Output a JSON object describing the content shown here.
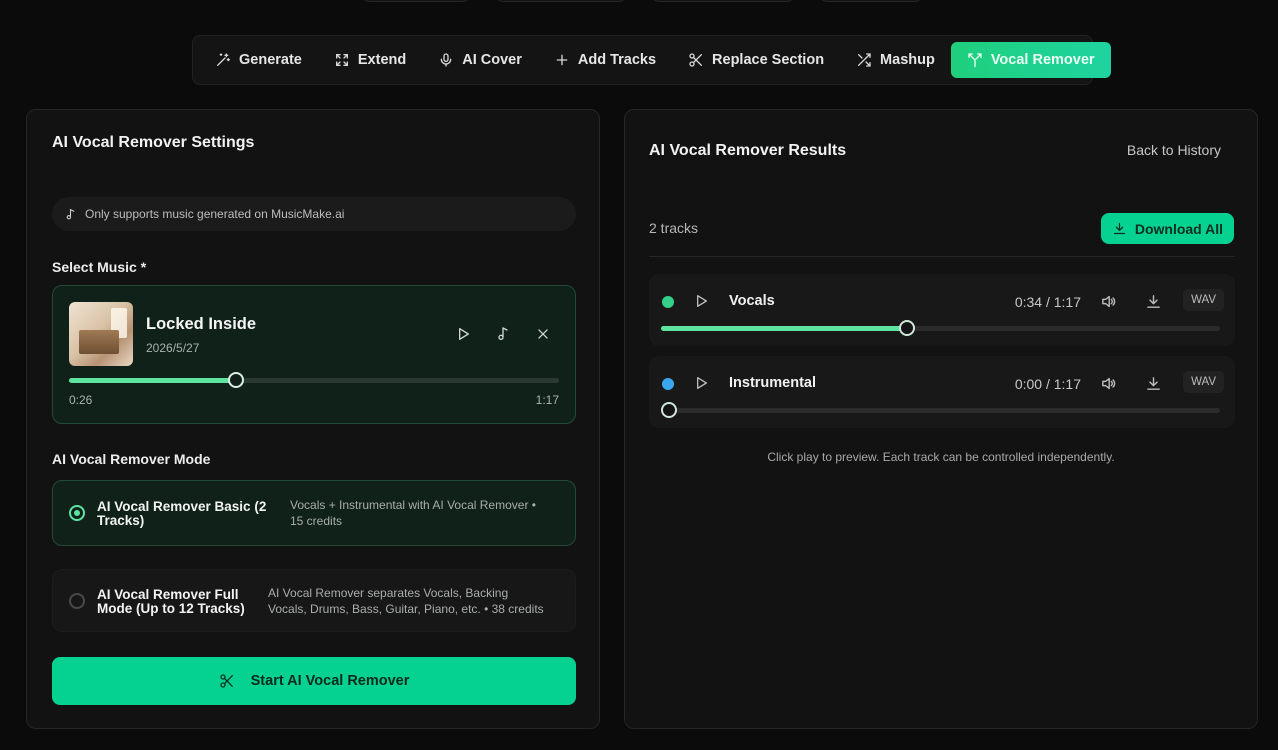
{
  "toolbar": {
    "tabs": [
      {
        "label": "Generate",
        "icon": "wand-icon"
      },
      {
        "label": "Extend",
        "icon": "expand-icon"
      },
      {
        "label": "AI Cover",
        "icon": "microphone-icon"
      },
      {
        "label": "Add Tracks",
        "icon": "plus-icon"
      },
      {
        "label": "Replace Section",
        "icon": "scissors-icon"
      },
      {
        "label": "Mashup",
        "icon": "shuffle-icon"
      },
      {
        "label": "Vocal Remover",
        "icon": "split-icon",
        "active": true
      }
    ]
  },
  "settings": {
    "title": "AI Vocal Remover Settings",
    "notice": "Only supports music generated on MusicMake.ai",
    "select_label": "Select Music *",
    "song": {
      "title": "Locked Inside",
      "date": "2026/5/27",
      "current": "0:26",
      "duration": "1:17",
      "progress": 0.34
    },
    "mode_label": "AI Vocal Remover Mode",
    "modes": [
      {
        "name_line1": "AI Vocal Remover Basic (2",
        "name_line2": "Tracks)",
        "desc_line1": "Vocals + Instrumental with AI Vocal Remover •",
        "desc_line2": "15 credits",
        "selected": true
      },
      {
        "name_line1": "AI Vocal Remover Full",
        "name_line2": "Mode (Up to 12 Tracks)",
        "desc_line1": "AI Vocal Remover separates Vocals, Backing",
        "desc_line2": "Vocals, Drums, Bass, Guitar, Piano, etc. • 38 credits",
        "selected": false
      }
    ],
    "start_label": "Start AI Vocal Remover"
  },
  "results": {
    "title": "AI Vocal Remover Results",
    "back_label": "Back to History",
    "count_label": "2 tracks",
    "download_all_label": "Download All",
    "tracks": [
      {
        "name": "Vocals",
        "time": "0:34 / 1:17",
        "format": "WAV",
        "progress": 0.44,
        "color": "#34d08a"
      },
      {
        "name": "Instrumental",
        "time": "0:00 / 1:17",
        "format": "WAV",
        "progress": 0.0,
        "color": "#3aa8f0"
      }
    ],
    "hint": "Click play to preview. Each track can be controlled independently."
  },
  "colors": {
    "accent": "#05d190",
    "accent_light": "#5fe3a1",
    "background": "#0b0b0b",
    "panel": "#121212"
  }
}
